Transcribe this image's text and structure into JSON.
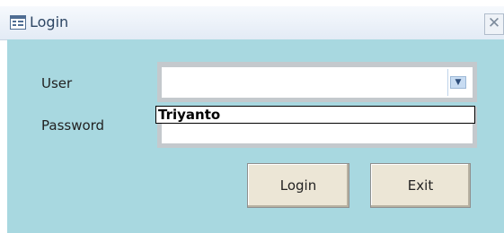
{
  "window": {
    "title": "Login",
    "close_label": "✕",
    "app_icon": "form-icon"
  },
  "form": {
    "user_label": "User",
    "password_label": "Password",
    "user_value": "",
    "password_value": "",
    "dropdown_items": [
      "Triyanto"
    ],
    "dropdown_arrow": "▼"
  },
  "buttons": {
    "login_label": "Login",
    "exit_label": "Exit"
  },
  "colors": {
    "form_background": "#a8d8e0",
    "titlebar": "#e3ebf5",
    "button_face": "#ece6d6"
  }
}
